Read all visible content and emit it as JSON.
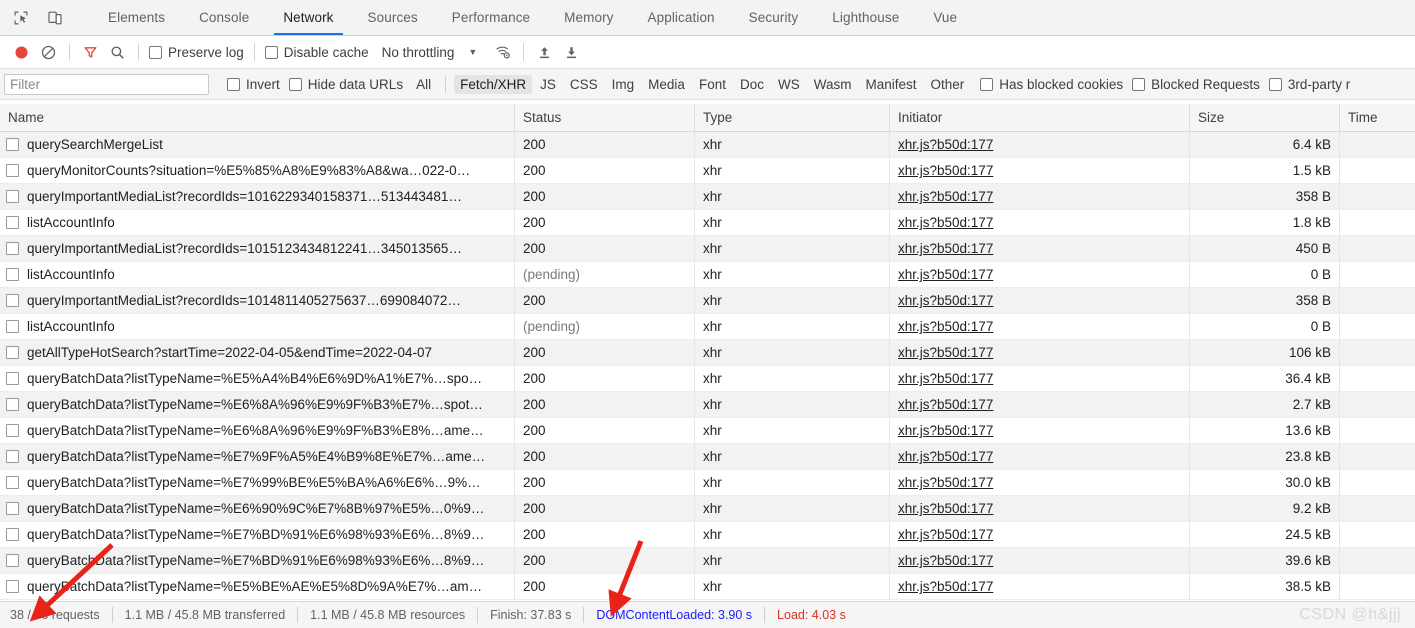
{
  "devtools": {
    "top_icons": [
      {
        "name": "inspect-element-icon"
      },
      {
        "name": "device-toolbar-icon"
      }
    ],
    "tabs": [
      {
        "label": "Elements",
        "active": false
      },
      {
        "label": "Console",
        "active": false
      },
      {
        "label": "Network",
        "active": true
      },
      {
        "label": "Sources",
        "active": false
      },
      {
        "label": "Performance",
        "active": false
      },
      {
        "label": "Memory",
        "active": false
      },
      {
        "label": "Application",
        "active": false
      },
      {
        "label": "Security",
        "active": false
      },
      {
        "label": "Lighthouse",
        "active": false
      },
      {
        "label": "Vue",
        "active": false
      }
    ],
    "accent_color": "#1a73e8"
  },
  "toolbar": {
    "record_icon": "record-stop-icon",
    "clear_icon": "clear-icon",
    "filter_icon": "filter-funnel-icon",
    "search_icon": "search-icon",
    "preserve_log_label": "Preserve log",
    "preserve_log_checked": false,
    "disable_cache_label": "Disable cache",
    "disable_cache_checked": false,
    "throttling_value": "No throttling",
    "throttling_caret": "▼",
    "wifi_icon": "network-conditions-icon",
    "import_icon": "import-har-icon",
    "export_icon": "export-har-icon",
    "record_color": "#e8453c",
    "filter_color": "#e8453c"
  },
  "filterbar": {
    "placeholder": "Filter",
    "value": "",
    "invert_label": "Invert",
    "invert_checked": false,
    "hide_data_urls_label": "Hide data URLs",
    "hide_data_urls_checked": false,
    "types": [
      {
        "label": "All",
        "selected": false
      },
      {
        "label": "Fetch/XHR",
        "selected": true
      },
      {
        "label": "JS",
        "selected": false
      },
      {
        "label": "CSS",
        "selected": false
      },
      {
        "label": "Img",
        "selected": false
      },
      {
        "label": "Media",
        "selected": false
      },
      {
        "label": "Font",
        "selected": false
      },
      {
        "label": "Doc",
        "selected": false
      },
      {
        "label": "WS",
        "selected": false
      },
      {
        "label": "Wasm",
        "selected": false
      },
      {
        "label": "Manifest",
        "selected": false
      },
      {
        "label": "Other",
        "selected": false
      }
    ],
    "has_blocked_cookies_label": "Has blocked cookies",
    "has_blocked_cookies_checked": false,
    "blocked_requests_label": "Blocked Requests",
    "blocked_requests_checked": false,
    "third_party_label": "3rd-party r",
    "third_party_checked": false
  },
  "table": {
    "columns": [
      {
        "label": "Name"
      },
      {
        "label": "Status"
      },
      {
        "label": "Type"
      },
      {
        "label": "Initiator"
      },
      {
        "label": "Size"
      },
      {
        "label": "Time"
      }
    ],
    "rows": [
      {
        "name": "querySearchMergeList",
        "status": "200",
        "type": "xhr",
        "initiator": "xhr.js?b50d:177",
        "size": "6.4 kB",
        "time": ""
      },
      {
        "name": "queryMonitorCounts?situation=%E5%85%A8%E9%83%A8&wa…022-0…",
        "status": "200",
        "type": "xhr",
        "initiator": "xhr.js?b50d:177",
        "size": "1.5 kB",
        "time": ""
      },
      {
        "name": "queryImportantMediaList?recordIds=1016229340158371…513443481…",
        "status": "200",
        "type": "xhr",
        "initiator": "xhr.js?b50d:177",
        "size": "358 B",
        "time": ""
      },
      {
        "name": "listAccountInfo",
        "status": "200",
        "type": "xhr",
        "initiator": "xhr.js?b50d:177",
        "size": "1.8 kB",
        "time": ""
      },
      {
        "name": "queryImportantMediaList?recordIds=1015123434812241…345013565…",
        "status": "200",
        "type": "xhr",
        "initiator": "xhr.js?b50d:177",
        "size": "450 B",
        "time": ""
      },
      {
        "name": "listAccountInfo",
        "status": "(pending)",
        "type": "xhr",
        "initiator": "xhr.js?b50d:177",
        "size": "0 B",
        "time": ""
      },
      {
        "name": "queryImportantMediaList?recordIds=1014811405275637…699084072…",
        "status": "200",
        "type": "xhr",
        "initiator": "xhr.js?b50d:177",
        "size": "358 B",
        "time": ""
      },
      {
        "name": "listAccountInfo",
        "status": "(pending)",
        "type": "xhr",
        "initiator": "xhr.js?b50d:177",
        "size": "0 B",
        "time": ""
      },
      {
        "name": "getAllTypeHotSearch?startTime=2022-04-05&endTime=2022-04-07",
        "status": "200",
        "type": "xhr",
        "initiator": "xhr.js?b50d:177",
        "size": "106 kB",
        "time": ""
      },
      {
        "name": "queryBatchData?listTypeName=%E5%A4%B4%E6%9D%A1%E7%…spo…",
        "status": "200",
        "type": "xhr",
        "initiator": "xhr.js?b50d:177",
        "size": "36.4 kB",
        "time": ""
      },
      {
        "name": "queryBatchData?listTypeName=%E6%8A%96%E9%9F%B3%E7%…spot…",
        "status": "200",
        "type": "xhr",
        "initiator": "xhr.js?b50d:177",
        "size": "2.7 kB",
        "time": ""
      },
      {
        "name": "queryBatchData?listTypeName=%E6%8A%96%E9%9F%B3%E8%…ame…",
        "status": "200",
        "type": "xhr",
        "initiator": "xhr.js?b50d:177",
        "size": "13.6 kB",
        "time": ""
      },
      {
        "name": "queryBatchData?listTypeName=%E7%9F%A5%E4%B9%8E%E7%…ame…",
        "status": "200",
        "type": "xhr",
        "initiator": "xhr.js?b50d:177",
        "size": "23.8 kB",
        "time": ""
      },
      {
        "name": "queryBatchData?listTypeName=%E7%99%BE%E5%BA%A6%E6%…9%…",
        "status": "200",
        "type": "xhr",
        "initiator": "xhr.js?b50d:177",
        "size": "30.0 kB",
        "time": ""
      },
      {
        "name": "queryBatchData?listTypeName=%E6%90%9C%E7%8B%97%E5%…0%9…",
        "status": "200",
        "type": "xhr",
        "initiator": "xhr.js?b50d:177",
        "size": "9.2 kB",
        "time": ""
      },
      {
        "name": "queryBatchData?listTypeName=%E7%BD%91%E6%98%93%E6%…8%9…",
        "status": "200",
        "type": "xhr",
        "initiator": "xhr.js?b50d:177",
        "size": "24.5 kB",
        "time": ""
      },
      {
        "name": "queryBatchData?listTypeName=%E7%BD%91%E6%98%93%E6%…8%9…",
        "status": "200",
        "type": "xhr",
        "initiator": "xhr.js?b50d:177",
        "size": "39.6 kB",
        "time": ""
      },
      {
        "name": "queryBatchData?listTypeName=%E5%BE%AE%E5%8D%9A%E7%…am…",
        "status": "200",
        "type": "xhr",
        "initiator": "xhr.js?b50d:177",
        "size": "38.5 kB",
        "time": ""
      }
    ]
  },
  "statusbar": {
    "requests": "38 / 76 requests",
    "transferred": "1.1 MB / 45.8 MB transferred",
    "resources": "1.1 MB / 45.8 MB resources",
    "finish": "Finish: 37.83 s",
    "domcontentloaded": "DOMContentLoaded: 3.90 s",
    "load": "Load: 4.03 s",
    "dcl_color": "#1a1aff",
    "load_color": "#d93025"
  },
  "watermark": {
    "text": "CSDN @h&jjj"
  },
  "annotations": {
    "arrow_color": "#e8241a",
    "arrows": [
      {
        "name": "arrow-to-requests-count"
      },
      {
        "name": "arrow-to-finish-time"
      }
    ]
  }
}
